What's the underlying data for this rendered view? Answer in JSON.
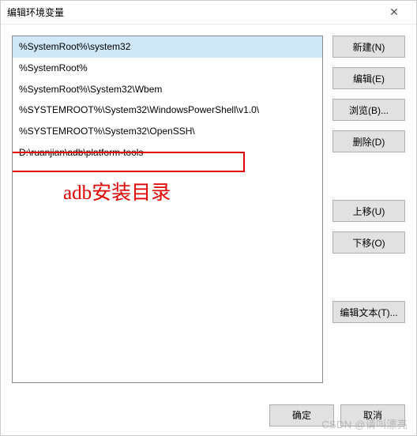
{
  "dialog": {
    "title": "编辑环境变量"
  },
  "list": {
    "items": [
      "%SystemRoot%\\system32",
      "%SystemRoot%",
      "%SystemRoot%\\System32\\Wbem",
      "%SYSTEMROOT%\\System32\\WindowsPowerShell\\v1.0\\",
      "%SYSTEMROOT%\\System32\\OpenSSH\\",
      "D:\\ruanjian\\adb\\platform-tools"
    ],
    "selected_index": 0,
    "highlighted_index": 5
  },
  "annotation": {
    "text": "adb安装目录"
  },
  "buttons": {
    "new": "新建(N)",
    "edit": "编辑(E)",
    "browse": "浏览(B)...",
    "delete": "删除(D)",
    "move_up": "上移(U)",
    "move_down": "下移(O)",
    "edit_text": "编辑文本(T)..."
  },
  "footer": {
    "ok": "确定",
    "cancel": "取消"
  },
  "watermark": "CSDN @请叫漂亮"
}
